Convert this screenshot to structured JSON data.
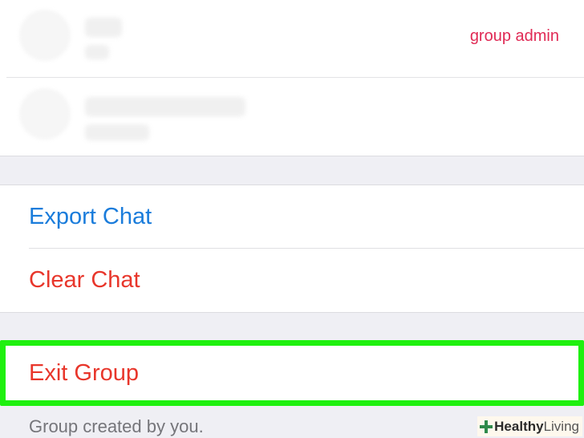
{
  "members": [
    {
      "role": "group admin"
    },
    {
      "role": ""
    }
  ],
  "actions": {
    "export_label": "Export Chat",
    "clear_label": "Clear Chat",
    "exit_label": "Exit Group"
  },
  "footer": {
    "created_text": "Group created by you."
  },
  "watermark": {
    "brand_bold": "Healthy",
    "brand_light": "Living"
  },
  "colors": {
    "link_blue": "#1a7cdb",
    "destructive_red": "#e8362b",
    "admin_pink": "#e02a55",
    "highlight_green": "#1ff00f",
    "grouped_background": "#efeff4"
  }
}
